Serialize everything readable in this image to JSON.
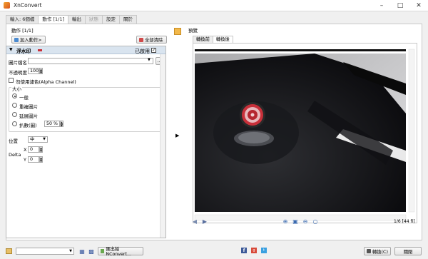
{
  "window": {
    "title": "XnConvert"
  },
  "tabs": [
    {
      "label": "輸入: 6個檔",
      "state": "normal"
    },
    {
      "label": "動作 [1/1]",
      "state": "active"
    },
    {
      "label": "輸出",
      "state": "normal"
    },
    {
      "label": "狀態",
      "state": "disabled"
    },
    {
      "label": "設定",
      "state": "normal"
    },
    {
      "label": "關於",
      "state": "normal"
    }
  ],
  "actions": {
    "section_label": "動作 [1/1]",
    "add_button": "加入動作>",
    "clear_button": "全部清除",
    "item": {
      "title": "浮水印",
      "enabled_label": "已啟用",
      "enabled": true,
      "image_file_label": "圖片檔名",
      "image_file_value": "",
      "browse_label": "...",
      "opacity_label": "不透明度",
      "opacity_value": "100",
      "alpha_label": "勿使用濾色(Alpha Channel)",
      "size_group_label": "大小",
      "size_options": [
        "一般",
        "重複圖片",
        "延展圖片",
        "扒數(圖)"
      ],
      "size_selected": "一般",
      "scale_value": "50 %",
      "position_label": "位置",
      "position_value": "中",
      "delta_label": "Delta",
      "x_label": "X",
      "x_value": "0",
      "y_label": "Y",
      "y_value": "0"
    }
  },
  "preview": {
    "label": "預覽",
    "tabs": [
      "轉換前",
      "轉換後"
    ],
    "active_tab": "轉換後",
    "counter": "1/6 [44 fi]"
  },
  "bottom": {
    "export_button": "匯出給NConvert...",
    "convert_button": "轉換(C)",
    "close_button": "關閉"
  },
  "icons": {
    "app": "xnconvert-logo-icon",
    "minimize": "minimize-icon",
    "maximize": "maximize-icon",
    "close": "close-icon"
  },
  "colors": {
    "accent_header": "#d9e4ef",
    "watermark_red": "#c8303a"
  }
}
